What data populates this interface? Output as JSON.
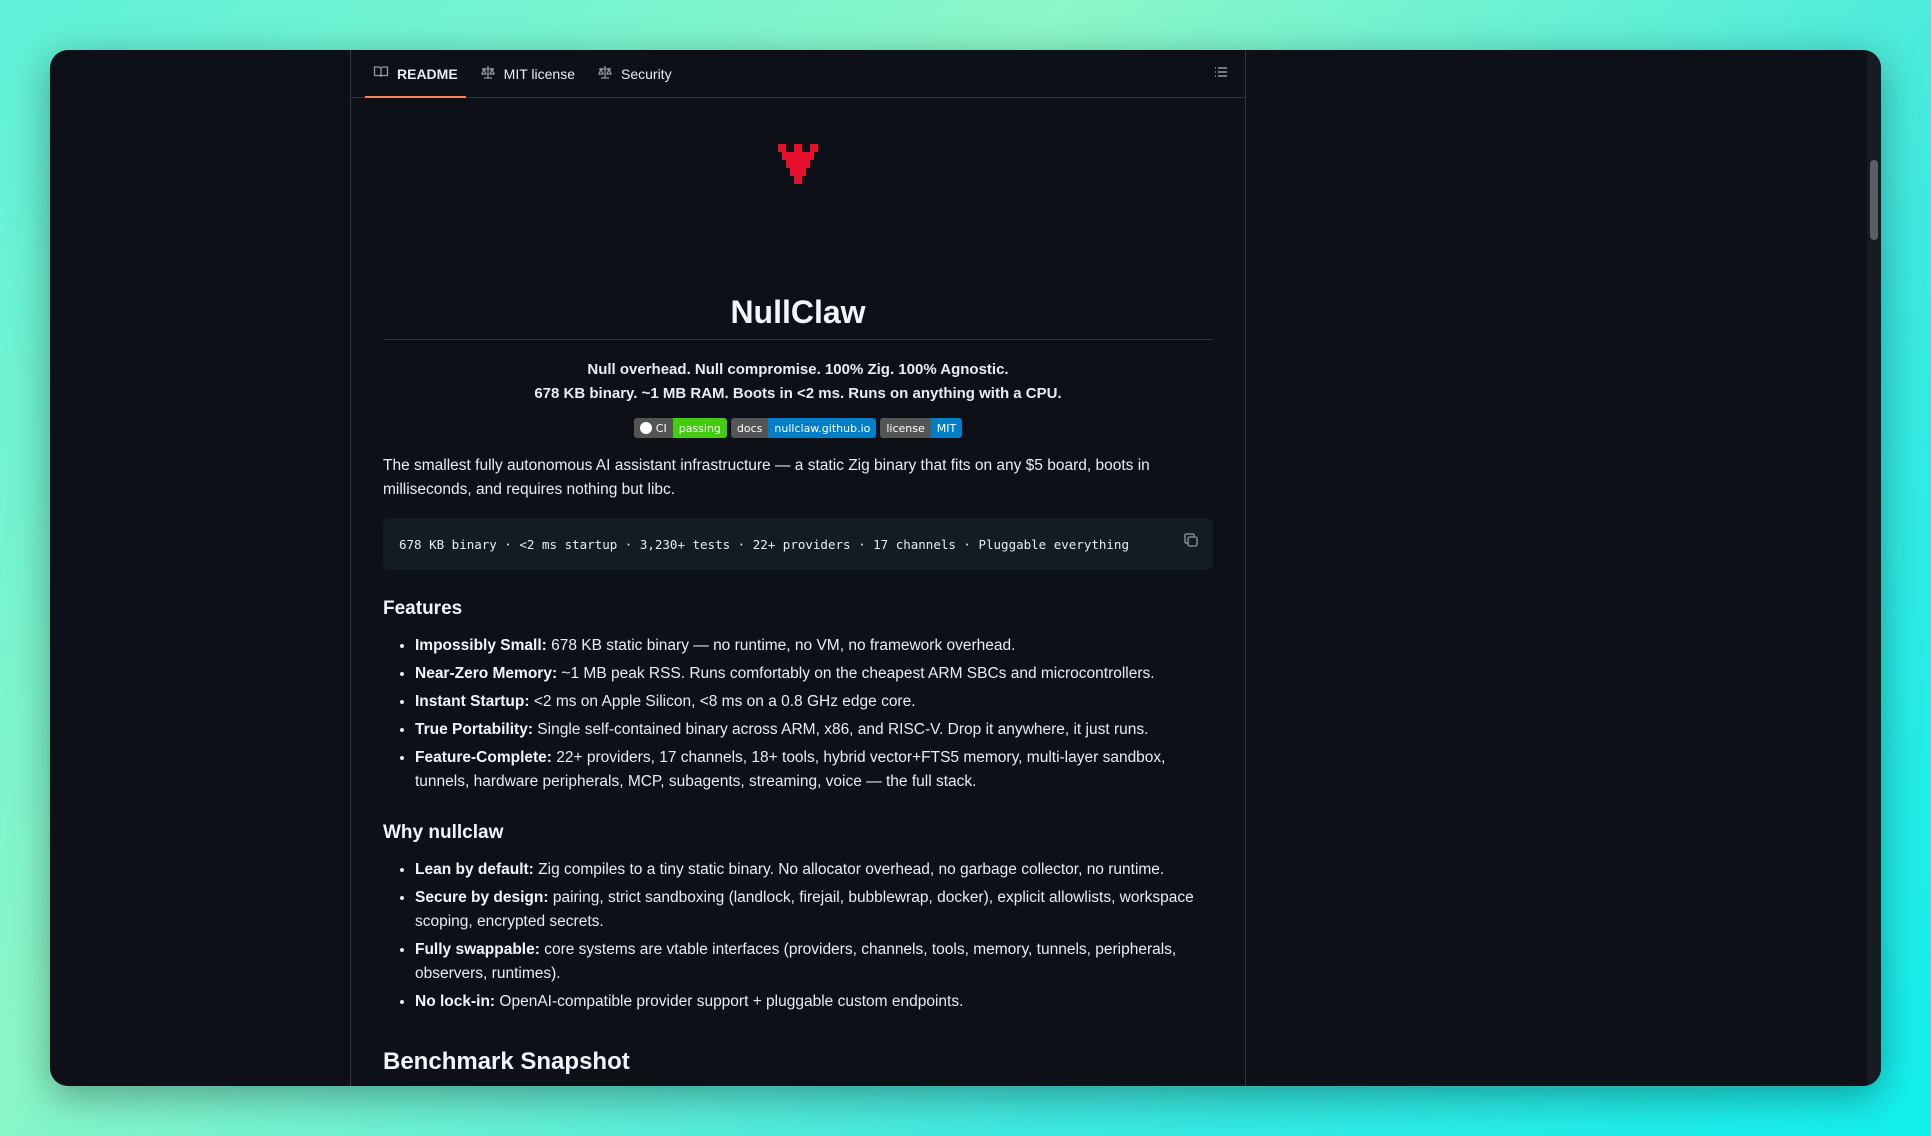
{
  "tabs": [
    {
      "label": "README",
      "icon": "book-icon",
      "active": true
    },
    {
      "label": "MIT license",
      "icon": "scale-icon",
      "active": false
    },
    {
      "label": "Security",
      "icon": "scale-icon",
      "active": false
    }
  ],
  "readme": {
    "title": "NullClaw",
    "tagline_1": "Null overhead. Null compromise. 100% Zig. 100% Agnostic.",
    "tagline_2": "678 KB binary. ~1 MB RAM. Boots in <2 ms. Runs on anything with a CPU.",
    "badges": [
      {
        "left": "CI",
        "right": "passing",
        "color": "#44cc11"
      },
      {
        "left": "docs",
        "right": "nullclaw.github.io",
        "color": "#007ec6"
      },
      {
        "left": "license",
        "right": "MIT",
        "color": "#007ec6"
      }
    ],
    "intro": "The smallest fully autonomous AI assistant infrastructure — a static Zig binary that fits on any $5 board, boots in milliseconds, and requires nothing but libc.",
    "code": "678 KB binary · <2 ms startup · 3,230+ tests · 22+ providers · 17 channels · Pluggable everything",
    "features_heading": "Features",
    "features": [
      {
        "bold": "Impossibly Small:",
        "text": " 678 KB static binary — no runtime, no VM, no framework overhead."
      },
      {
        "bold": "Near-Zero Memory:",
        "text": " ~1 MB peak RSS. Runs comfortably on the cheapest ARM SBCs and microcontrollers."
      },
      {
        "bold": "Instant Startup:",
        "text": " <2 ms on Apple Silicon, <8 ms on a 0.8 GHz edge core."
      },
      {
        "bold": "True Portability:",
        "text": " Single self-contained binary across ARM, x86, and RISC-V. Drop it anywhere, it just runs."
      },
      {
        "bold": "Feature-Complete:",
        "text": " 22+ providers, 17 channels, 18+ tools, hybrid vector+FTS5 memory, multi-layer sandbox, tunnels, hardware peripherals, MCP, subagents, streaming, voice — the full stack."
      }
    ],
    "why_heading": "Why nullclaw",
    "why": [
      {
        "bold": "Lean by default:",
        "text": " Zig compiles to a tiny static binary. No allocator overhead, no garbage collector, no runtime."
      },
      {
        "bold": "Secure by design:",
        "text": " pairing, strict sandboxing (landlock, firejail, bubblewrap, docker), explicit allowlists, workspace scoping, encrypted secrets."
      },
      {
        "bold": "Fully swappable:",
        "text": " core systems are vtable interfaces (providers, channels, tools, memory, tunnels, peripherals, observers, runtimes)."
      },
      {
        "bold": "No lock-in:",
        "text": " OpenAI-compatible provider support + pluggable custom endpoints."
      }
    ],
    "benchmark_heading": "Benchmark Snapshot"
  },
  "colors": {
    "accent_tab": "#f78166",
    "logo": "#e8112d",
    "background": "#0d1117"
  }
}
